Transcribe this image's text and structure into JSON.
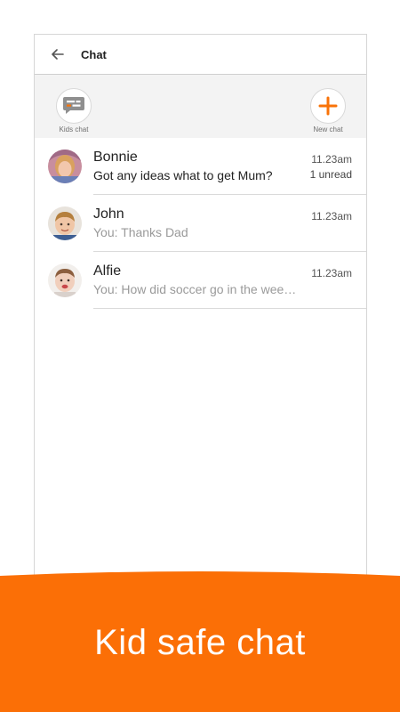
{
  "header": {
    "title": "Chat"
  },
  "actions": {
    "kids_chat_label": "Kids chat",
    "new_chat_label": "New chat"
  },
  "chats": [
    {
      "name": "Bonnie",
      "message": "Got any ideas what to get Mum?",
      "time": "11.23am",
      "status": "1 unread"
    },
    {
      "name": "John",
      "message": "You: Thanks Dad",
      "time": "11.23am",
      "status": ""
    },
    {
      "name": "Alfie",
      "message": "You: How did soccer go in the weekend?",
      "time": "11.23am",
      "status": ""
    }
  ],
  "banner": {
    "text": "Kid safe chat"
  },
  "colors": {
    "accent": "#f97308",
    "banner": "#fb6f06"
  }
}
